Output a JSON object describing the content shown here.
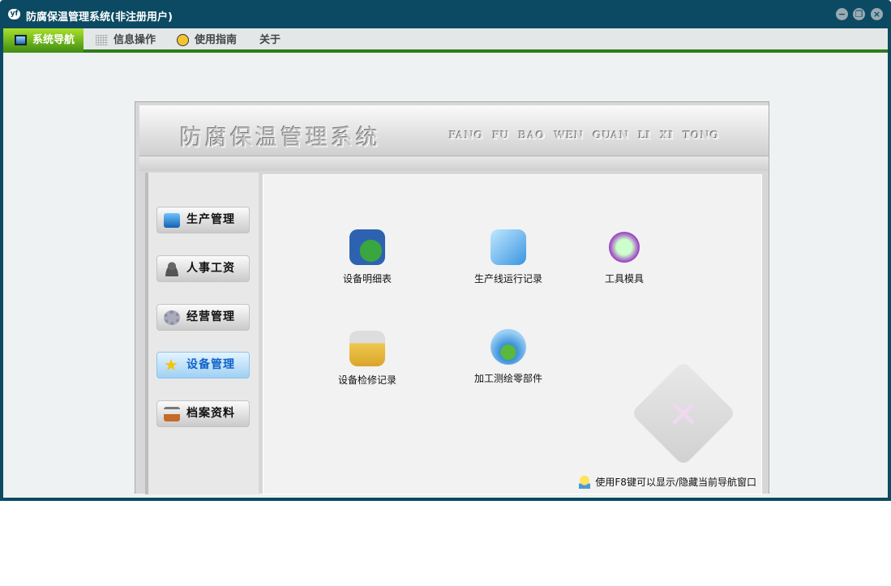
{
  "window": {
    "title": "防腐保温管理系统(非注册用户)",
    "app_icon": "yf",
    "controls": [
      "minimize",
      "restore",
      "close"
    ]
  },
  "menu": [
    {
      "label": "系统导航",
      "icon": "monitor-icon",
      "active": true
    },
    {
      "label": "信息操作",
      "icon": "grid-icon"
    },
    {
      "label": "使用指南",
      "icon": "help-icon"
    },
    {
      "label": "关于"
    }
  ],
  "banner": {
    "title_cn": "防腐保温管理系统",
    "title_en": "FANG FU BAO WEN GUAN LI XI TONG"
  },
  "nav": [
    {
      "label": "生产管理",
      "icon": "monitor-icon"
    },
    {
      "label": "人事工资",
      "icon": "user-icon"
    },
    {
      "label": "经营管理",
      "icon": "gear-icon"
    },
    {
      "label": "设备管理",
      "icon": "star-icon",
      "active": true
    },
    {
      "label": "档案资料",
      "icon": "house-icon"
    }
  ],
  "tiles": [
    {
      "label": "设备明细表",
      "icon": "globe-book-icon"
    },
    {
      "label": "生产线运行记录",
      "icon": "folder-doc-icon"
    },
    {
      "label": "工具模具",
      "icon": "magnifier-icon"
    },
    {
      "label": "设备检修记录",
      "icon": "gear-folder-icon"
    },
    {
      "label": "加工测绘零部件",
      "icon": "network-globe-icon"
    }
  ],
  "hint": "使用F8键可以显示/隐藏当前导航窗口",
  "colors": {
    "frame": "#0b4a62",
    "menu_accent": "#2f7c1a",
    "active_nav": "#1164c8"
  }
}
